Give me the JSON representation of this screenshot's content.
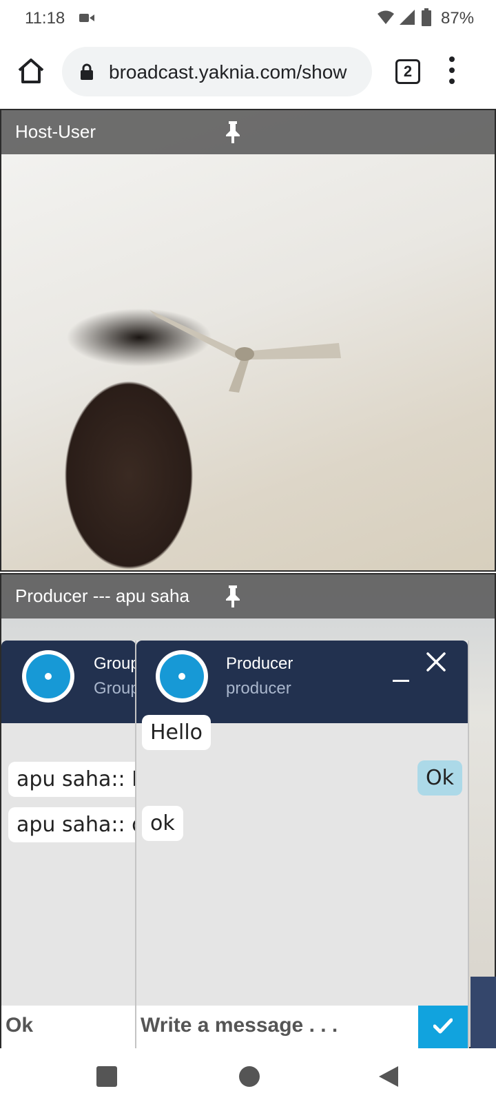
{
  "status_bar": {
    "time": "11:18",
    "battery_percent": "87%",
    "icons": [
      "video-camera-icon",
      "wifi-icon",
      "cellular-signal-icon",
      "battery-icon"
    ]
  },
  "browser": {
    "url": "broadcast.yaknia.com/show",
    "tab_count": "2",
    "icons": [
      "home-icon",
      "lock-icon",
      "more-vert-icon"
    ]
  },
  "video_tiles": [
    {
      "title": "Host-User",
      "pin_icon": "pin-icon"
    },
    {
      "title": "Producer --- apu saha",
      "pin_icon": "pin-icon"
    }
  ],
  "chat_group": {
    "name": "Group",
    "subtitle": "Group",
    "messages": [
      "apu saha:: Hello",
      "apu saha:: ok"
    ],
    "input_value": "Ok"
  },
  "chat_producer": {
    "name": "Producer",
    "subtitle": "producer",
    "messages": [
      {
        "text": "Hello",
        "mine": false
      },
      {
        "text": "Ok",
        "mine": true
      },
      {
        "text": "ok",
        "mine": false
      }
    ],
    "input_placeholder": "Write a message . . .",
    "send_icon": "checkmark-icon"
  },
  "colors": {
    "chat_header": "#22314f",
    "accent_blue": "#11a3de",
    "avatar_blue": "#1799d6",
    "my_bubble": "#acd9e8",
    "chat_bg": "#e5e5e5"
  },
  "nav_bar": {
    "icons": [
      "recent-apps-icon",
      "home-circle-icon",
      "back-triangle-icon"
    ]
  }
}
